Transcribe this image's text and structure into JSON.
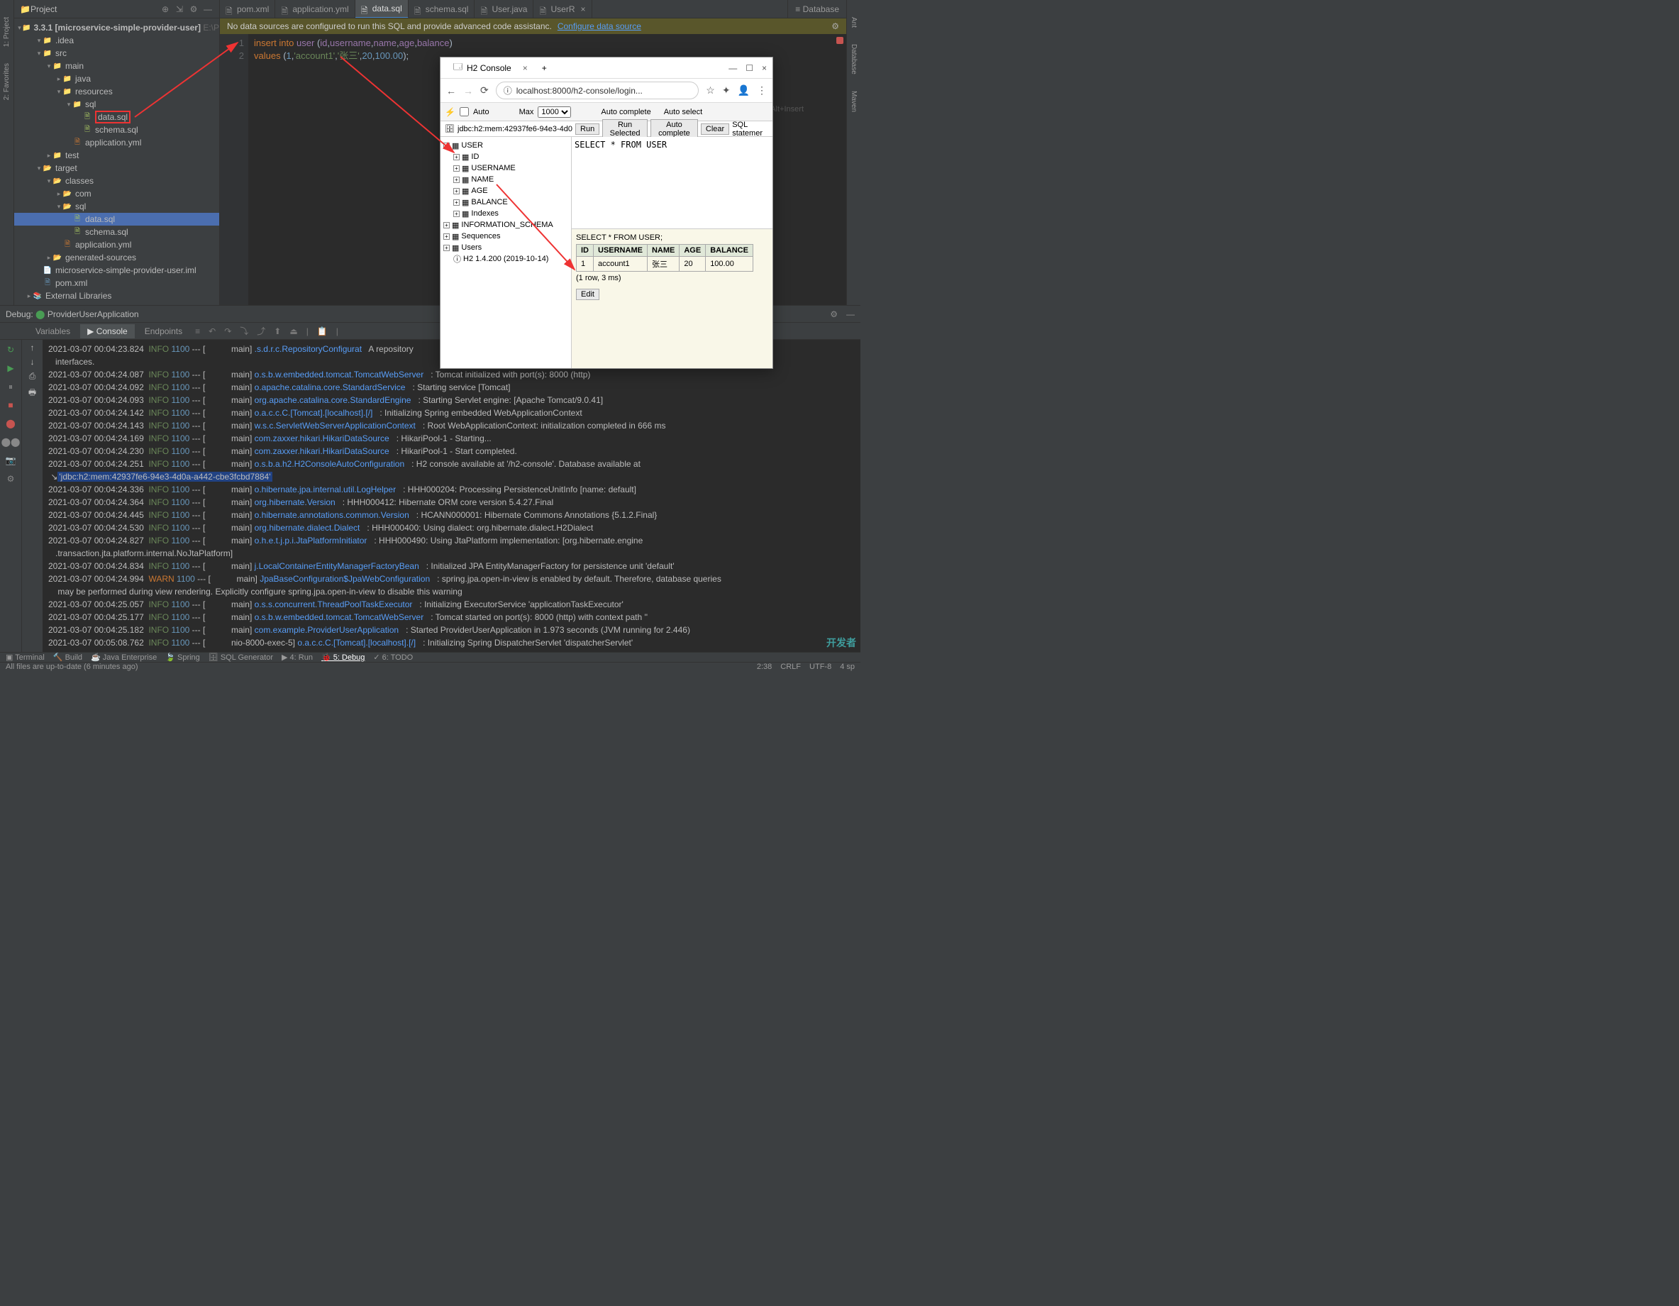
{
  "project": {
    "title": "Project",
    "root": "3.3.1 [microservice-simple-provider-user]",
    "root_hint": "E:\\P",
    "nodes": [
      {
        "d": 1,
        "exp": "▾",
        "icon": "folder",
        "label": ".idea"
      },
      {
        "d": 1,
        "exp": "▾",
        "icon": "folder",
        "label": "src"
      },
      {
        "d": 2,
        "exp": "▾",
        "icon": "folder",
        "label": "main"
      },
      {
        "d": 3,
        "exp": "▸",
        "icon": "folder",
        "label": "java"
      },
      {
        "d": 3,
        "exp": "▾",
        "icon": "folder",
        "label": "resources"
      },
      {
        "d": 4,
        "exp": "▾",
        "icon": "folder",
        "label": "sql"
      },
      {
        "d": 5,
        "exp": "",
        "icon": "sql",
        "label": "data.sql",
        "hl": true
      },
      {
        "d": 5,
        "exp": "",
        "icon": "sql",
        "label": "schema.sql"
      },
      {
        "d": 4,
        "exp": "",
        "icon": "yml",
        "label": "application.yml"
      },
      {
        "d": 2,
        "exp": "▸",
        "icon": "folder",
        "label": "test"
      },
      {
        "d": 1,
        "exp": "▾",
        "icon": "folder-o",
        "label": "target"
      },
      {
        "d": 2,
        "exp": "▾",
        "icon": "folder-o",
        "label": "classes"
      },
      {
        "d": 3,
        "exp": "▸",
        "icon": "folder-o",
        "label": "com"
      },
      {
        "d": 3,
        "exp": "▾",
        "icon": "folder-o",
        "label": "sql"
      },
      {
        "d": 4,
        "exp": "",
        "icon": "sql",
        "label": "data.sql",
        "sel": true
      },
      {
        "d": 4,
        "exp": "",
        "icon": "sql",
        "label": "schema.sql"
      },
      {
        "d": 3,
        "exp": "",
        "icon": "yml",
        "label": "application.yml"
      },
      {
        "d": 2,
        "exp": "▸",
        "icon": "folder-o",
        "label": "generated-sources"
      },
      {
        "d": 1,
        "exp": "",
        "icon": "file",
        "label": "microservice-simple-provider-user.iml"
      },
      {
        "d": 1,
        "exp": "",
        "icon": "xml",
        "label": "pom.xml"
      },
      {
        "d": 0,
        "exp": "▸",
        "icon": "lib",
        "label": "External Libraries"
      }
    ]
  },
  "tabs": [
    {
      "icon": "xml",
      "label": "pom.xml"
    },
    {
      "icon": "yml",
      "label": "application.yml"
    },
    {
      "icon": "sql",
      "label": "data.sql",
      "active": true
    },
    {
      "icon": "sql",
      "label": "schema.sql"
    },
    {
      "icon": "java",
      "label": "User.java"
    },
    {
      "icon": "java",
      "label": "UserR",
      "close": "×"
    }
  ],
  "db_tab": "Database",
  "banner": {
    "text": "No data sources are configured to run this SQL and provide advanced code assistanc.",
    "link": "Configure data source"
  },
  "code": {
    "lines": [
      "1",
      "2"
    ],
    "l1_kw1": "insert",
    "l1_kw2": "into",
    "l1_tbl": "user",
    "l1_cols": "(id,username,name,age,balance)",
    "l2_kw": "values",
    "l2_vals": "(1,'account1','张三',20,100.00);"
  },
  "hint": "h Alt+Insert",
  "debug": {
    "title": "Debug:",
    "run_config": "ProviderUserApplication",
    "tabs": [
      "Variables",
      "Console",
      "Endpoints"
    ],
    "active_tab": 1
  },
  "logs": [
    {
      "ts": "2021-03-07 00:04:23.824",
      "lvl": "INFO",
      "pid": "1100",
      "th": "main",
      "cls": ".s.d.r.c.RepositoryConfigurat",
      "msg": "A repository"
    },
    {
      "cont": "interfaces."
    },
    {
      "ts": "2021-03-07 00:04:24.087",
      "lvl": "INFO",
      "pid": "1100",
      "th": "main",
      "cls": "o.s.b.w.embedded.tomcat.TomcatWebServer",
      "msg": ": Tomcat initialized with port(s): 8000 (http)"
    },
    {
      "ts": "2021-03-07 00:04:24.092",
      "lvl": "INFO",
      "pid": "1100",
      "th": "main",
      "cls": "o.apache.catalina.core.StandardService",
      "msg": ": Starting service [Tomcat]"
    },
    {
      "ts": "2021-03-07 00:04:24.093",
      "lvl": "INFO",
      "pid": "1100",
      "th": "main",
      "cls": "org.apache.catalina.core.StandardEngine",
      "msg": ": Starting Servlet engine: [Apache Tomcat/9.0.41]"
    },
    {
      "ts": "2021-03-07 00:04:24.142",
      "lvl": "INFO",
      "pid": "1100",
      "th": "main",
      "cls": "o.a.c.c.C.[Tomcat].[localhost].[/]",
      "msg": ": Initializing Spring embedded WebApplicationContext"
    },
    {
      "ts": "2021-03-07 00:04:24.143",
      "lvl": "INFO",
      "pid": "1100",
      "th": "main",
      "cls": "w.s.c.ServletWebServerApplicationContext",
      "msg": ": Root WebApplicationContext: initialization completed in 666 ms"
    },
    {
      "ts": "2021-03-07 00:04:24.169",
      "lvl": "INFO",
      "pid": "1100",
      "th": "main",
      "cls": "com.zaxxer.hikari.HikariDataSource",
      "msg": ": HikariPool-1 - Starting..."
    },
    {
      "ts": "2021-03-07 00:04:24.230",
      "lvl": "INFO",
      "pid": "1100",
      "th": "main",
      "cls": "com.zaxxer.hikari.HikariDataSource",
      "msg": ": HikariPool-1 - Start completed."
    },
    {
      "ts": "2021-03-07 00:04:24.251",
      "lvl": "INFO",
      "pid": "1100",
      "th": "main",
      "cls": "o.s.b.a.h2.H2ConsoleAutoConfiguration",
      "msg": ": H2 console available at '/h2-console'. Database available at "
    },
    {
      "hl": "'jdbc:h2:mem:42937fe6-94e3-4d0a-a442-cbe3fcbd7884'"
    },
    {
      "ts": "2021-03-07 00:04:24.336",
      "lvl": "INFO",
      "pid": "1100",
      "th": "main",
      "cls": "o.hibernate.jpa.internal.util.LogHelper",
      "msg": ": HHH000204: Processing PersistenceUnitInfo [name: default]"
    },
    {
      "ts": "2021-03-07 00:04:24.364",
      "lvl": "INFO",
      "pid": "1100",
      "th": "main",
      "cls": "org.hibernate.Version",
      "msg": ": HHH000412: Hibernate ORM core version 5.4.27.Final"
    },
    {
      "ts": "2021-03-07 00:04:24.445",
      "lvl": "INFO",
      "pid": "1100",
      "th": "main",
      "cls": "o.hibernate.annotations.common.Version",
      "msg": ": HCANN000001: Hibernate Commons Annotations {5.1.2.Final}"
    },
    {
      "ts": "2021-03-07 00:04:24.530",
      "lvl": "INFO",
      "pid": "1100",
      "th": "main",
      "cls": "org.hibernate.dialect.Dialect",
      "msg": ": HHH000400: Using dialect: org.hibernate.dialect.H2Dialect"
    },
    {
      "ts": "2021-03-07 00:04:24.827",
      "lvl": "INFO",
      "pid": "1100",
      "th": "main",
      "cls": "o.h.e.t.j.p.i.JtaPlatformInitiator",
      "msg": ": HHH000490: Using JtaPlatform implementation: [org.hibernate.engine"
    },
    {
      "cont": ".transaction.jta.platform.internal.NoJtaPlatform]"
    },
    {
      "ts": "2021-03-07 00:04:24.834",
      "lvl": "INFO",
      "pid": "1100",
      "th": "main",
      "cls": "j.LocalContainerEntityManagerFactoryBean",
      "msg": ": Initialized JPA EntityManagerFactory for persistence unit 'default'"
    },
    {
      "ts": "2021-03-07 00:04:24.994",
      "lvl": "WARN",
      "pid": "1100",
      "th": "main",
      "cls": "JpaBaseConfiguration$JpaWebConfiguration",
      "msg": ": spring.jpa.open-in-view is enabled by default. Therefore, database queries"
    },
    {
      "cont": " may be performed during view rendering. Explicitly configure spring.jpa.open-in-view to disable this warning"
    },
    {
      "ts": "2021-03-07 00:04:25.057",
      "lvl": "INFO",
      "pid": "1100",
      "th": "main",
      "cls": "o.s.s.concurrent.ThreadPoolTaskExecutor",
      "msg": ": Initializing ExecutorService 'applicationTaskExecutor'"
    },
    {
      "ts": "2021-03-07 00:04:25.177",
      "lvl": "INFO",
      "pid": "1100",
      "th": "main",
      "cls": "o.s.b.w.embedded.tomcat.TomcatWebServer",
      "msg": ": Tomcat started on port(s): 8000 (http) with context path ''"
    },
    {
      "ts": "2021-03-07 00:04:25.182",
      "lvl": "INFO",
      "pid": "1100",
      "th": "main",
      "cls": "com.example.ProviderUserApplication",
      "msg": ": Started ProviderUserApplication in 1.973 seconds (JVM running for 2.446)"
    },
    {
      "ts": "2021-03-07 00:05:08.762",
      "lvl": "INFO",
      "pid": "1100",
      "th": "nio-8000-exec-5",
      "cls": "o.a.c.c.C.[Tomcat].[localhost].[/]",
      "msg": ": Initializing Spring DispatcherServlet 'dispatcherServlet'"
    }
  ],
  "bottom_tabs": [
    "Terminal",
    "Build",
    "Java Enterprise",
    "Spring",
    "SQL Generator",
    "4: Run",
    "5: Debug",
    "6: TODO"
  ],
  "bottom_active": 6,
  "status": {
    "left": "All files are up-to-date (6 minutes ago)",
    "pos": "2:38",
    "eol": "CRLF",
    "enc": "UTF-8",
    "sp": "4 sp"
  },
  "h2": {
    "tab_title": "H2 Console",
    "url": "localhost:8000/h2-console/login...",
    "auto_lbl": "Auto",
    "max_lbl": "Max",
    "max_val": "1000",
    "ac_lbl": "Auto complete",
    "as_lbl": "Auto select",
    "jdbc": "jdbc:h2:mem:42937fe6-94e3-4d0",
    "btns": [
      "Run",
      "Run Selected",
      "Auto complete",
      "Clear"
    ],
    "stmt_lbl": "SQL statemer",
    "tree": [
      {
        "d": 0,
        "exp": "-",
        "label": "USER"
      },
      {
        "d": 1,
        "exp": "+",
        "label": "ID"
      },
      {
        "d": 1,
        "exp": "+",
        "label": "USERNAME"
      },
      {
        "d": 1,
        "exp": "+",
        "label": "NAME"
      },
      {
        "d": 1,
        "exp": "+",
        "label": "AGE"
      },
      {
        "d": 1,
        "exp": "+",
        "label": "BALANCE"
      },
      {
        "d": 1,
        "exp": "+",
        "label": "Indexes"
      },
      {
        "d": 0,
        "exp": "+",
        "label": "INFORMATION_SCHEMA"
      },
      {
        "d": 0,
        "exp": "+",
        "label": "Sequences"
      },
      {
        "d": 0,
        "exp": "+",
        "label": "Users"
      },
      {
        "d": 0,
        "exp": "",
        "label": "H2 1.4.200 (2019-10-14)",
        "info": true
      }
    ],
    "sql": "SELECT * FROM USER",
    "result_q": "SELECT * FROM USER;",
    "cols": [
      "ID",
      "USERNAME",
      "NAME",
      "AGE",
      "BALANCE"
    ],
    "rows": [
      [
        "1",
        "account1",
        "张三",
        "20",
        "100.00"
      ]
    ],
    "rowinfo": "(1 row, 3 ms)",
    "edit": "Edit"
  },
  "watermark": "开发者"
}
